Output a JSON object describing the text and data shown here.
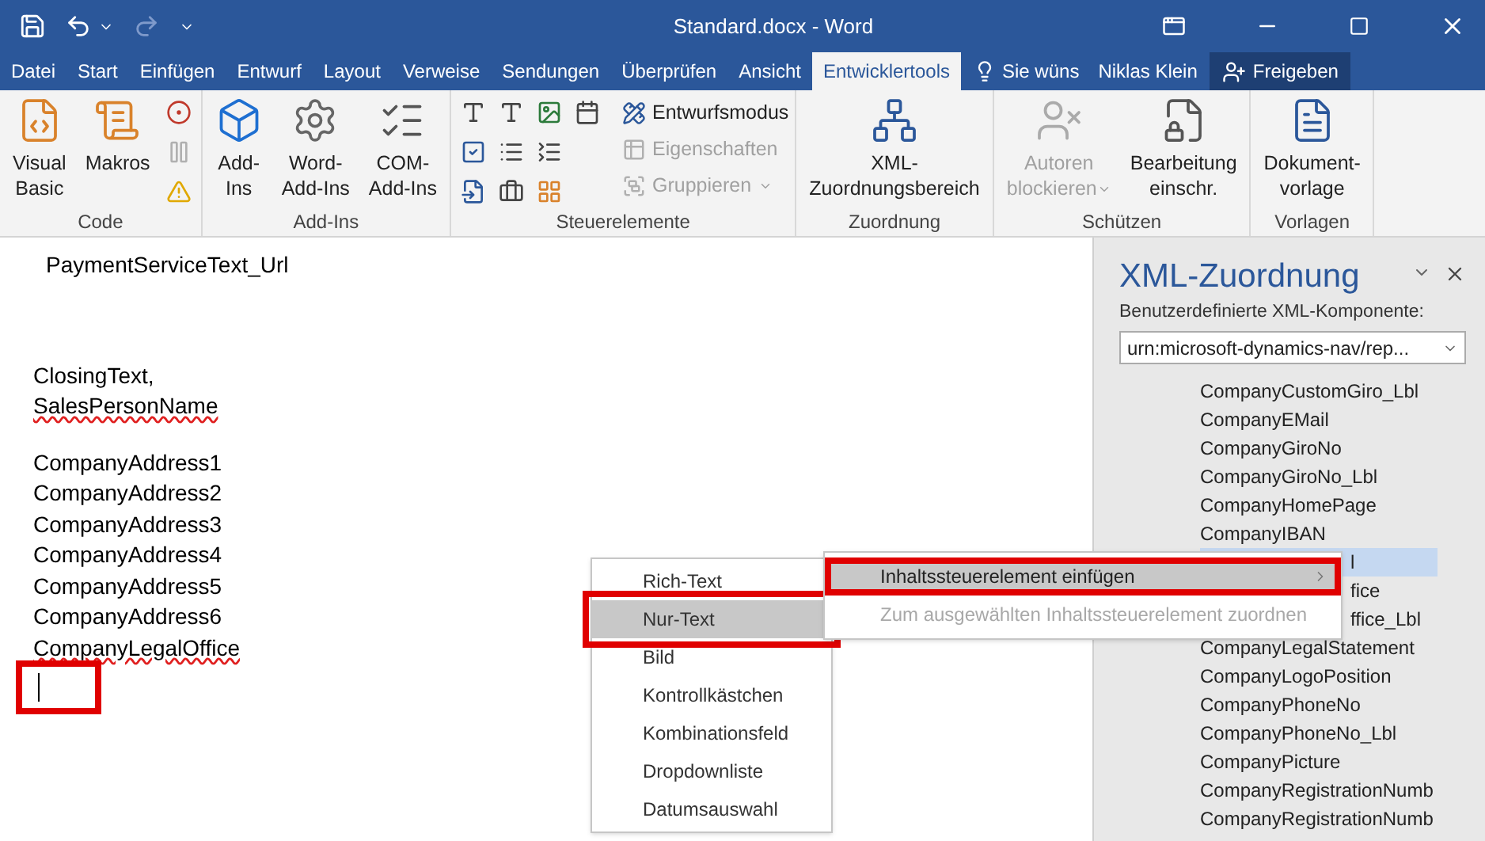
{
  "window": {
    "title": "Standard.docx - Word",
    "redo_disabled": true
  },
  "tabs": [
    {
      "label": "Datei",
      "selected": false
    },
    {
      "label": "Start",
      "selected": false
    },
    {
      "label": "Einfügen",
      "selected": false
    },
    {
      "label": "Entwurf",
      "selected": false
    },
    {
      "label": "Layout",
      "selected": false
    },
    {
      "label": "Verweise",
      "selected": false
    },
    {
      "label": "Sendungen",
      "selected": false
    },
    {
      "label": "Überprüfen",
      "selected": false
    },
    {
      "label": "Ansicht",
      "selected": false
    },
    {
      "label": "Entwicklertools",
      "selected": true
    }
  ],
  "tell_me": "Sie wüns",
  "user": "Niklas Klein",
  "share_button": "Freigeben",
  "ribbon_groups": [
    {
      "label": "Code",
      "items": [
        {
          "kind": "large",
          "lines": [
            "Visual",
            "Basic"
          ],
          "disabled": false
        },
        {
          "kind": "large",
          "lines": [
            "Makros"
          ],
          "disabled": false
        },
        {
          "kind": "icon",
          "disabled": false
        },
        {
          "kind": "icon",
          "disabled": true
        },
        {
          "kind": "icon",
          "disabled": false
        }
      ]
    },
    {
      "label": "Add-Ins",
      "items": [
        {
          "kind": "large",
          "lines": [
            "Add-",
            "Ins"
          ],
          "disabled": false
        },
        {
          "kind": "large",
          "lines": [
            "Word-",
            "Add-Ins"
          ],
          "disabled": false
        },
        {
          "kind": "large",
          "lines": [
            "COM-",
            "Add-Ins"
          ],
          "disabled": false
        }
      ]
    },
    {
      "label": "Steuerelemente",
      "items": [
        {
          "kind": "icon",
          "disabled": false
        },
        {
          "kind": "icon",
          "disabled": false
        },
        {
          "kind": "icon",
          "disabled": false
        },
        {
          "kind": "icon",
          "disabled": false
        },
        {
          "kind": "icon",
          "disabled": false
        },
        {
          "kind": "icon",
          "disabled": false
        },
        {
          "kind": "icon",
          "disabled": false
        },
        {
          "kind": "icon",
          "disabled": false
        },
        {
          "kind": "icon",
          "disabled": false
        },
        {
          "kind": "icon",
          "disabled": false
        },
        {
          "kind": "small",
          "label": "Entwurfsmodus",
          "disabled": false,
          "has_menu": false
        },
        {
          "kind": "small",
          "label": "Eigenschaften",
          "disabled": true,
          "has_menu": false
        },
        {
          "kind": "small",
          "label": "Gruppieren",
          "disabled": true,
          "has_menu": true
        }
      ]
    },
    {
      "label": "Zuordnung",
      "items": [
        {
          "kind": "large",
          "lines": [
            "XML-",
            "Zuordnungsbereich"
          ],
          "disabled": false
        }
      ]
    },
    {
      "label": "Schützen",
      "items": [
        {
          "kind": "large",
          "lines": [
            "Autoren",
            "blockieren"
          ],
          "disabled": true,
          "has_menu": true
        },
        {
          "kind": "large",
          "lines": [
            "Bearbeitung",
            "einschr."
          ],
          "disabled": false
        }
      ]
    },
    {
      "label": "Vorlagen",
      "items": [
        {
          "kind": "large",
          "lines": [
            "Dokument-",
            "vorlage"
          ],
          "disabled": false
        }
      ]
    }
  ],
  "document": {
    "blocks": [
      [
        {
          "text": "PaymentServiceText_Url",
          "spelling_error": false
        }
      ],
      [
        {
          "text": "ClosingText,",
          "spelling_error": false
        },
        {
          "text": "SalesPersonName",
          "spelling_error": true
        }
      ],
      [
        {
          "text": "CompanyAddress1",
          "spelling_error": false
        },
        {
          "text": "CompanyAddress2",
          "spelling_error": false
        },
        {
          "text": "CompanyAddress3",
          "spelling_error": false
        },
        {
          "text": "CompanyAddress4",
          "spelling_error": false
        },
        {
          "text": "CompanyAddress5",
          "spelling_error": false
        },
        {
          "text": "CompanyAddress6",
          "spelling_error": false
        },
        {
          "text": "CompanyLegalOffice",
          "spelling_error": true
        }
      ]
    ],
    "cursor_annotated": true
  },
  "xml_pane": {
    "title": "XML-Zuordnung",
    "label": "Benutzerdefinierte XML-Komponente:",
    "dropdown_value": "urn:microsoft-dynamics-nav/rep...",
    "items": [
      {
        "text": "CompanyCustomGiro_Lbl",
        "selected": false,
        "partial": false
      },
      {
        "text": "CompanyEMail",
        "selected": false,
        "partial": false
      },
      {
        "text": "CompanyGiroNo",
        "selected": false,
        "partial": false
      },
      {
        "text": "CompanyGiroNo_Lbl",
        "selected": false,
        "partial": false
      },
      {
        "text": "CompanyHomePage",
        "selected": false,
        "partial": false
      },
      {
        "text": "CompanyIBAN",
        "selected": false,
        "partial": false
      },
      {
        "text": "l",
        "selected": true,
        "partial": true
      },
      {
        "text": "fice",
        "selected": false,
        "partial": true
      },
      {
        "text": "ffice_Lbl",
        "selected": false,
        "partial": true
      },
      {
        "text": "CompanyLegalStatement",
        "selected": false,
        "partial": false
      },
      {
        "text": "CompanyLogoPosition",
        "selected": false,
        "partial": false
      },
      {
        "text": "CompanyPhoneNo",
        "selected": false,
        "partial": false
      },
      {
        "text": "CompanyPhoneNo_Lbl",
        "selected": false,
        "partial": false
      },
      {
        "text": "CompanyPicture",
        "selected": false,
        "partial": false
      },
      {
        "text": "CompanyRegistrationNumb",
        "selected": false,
        "partial": false
      },
      {
        "text": "CompanyRegistrationNumb",
        "selected": false,
        "partial": false
      }
    ]
  },
  "context_menu": [
    {
      "label": "Inhaltssteuerelement einfügen",
      "hovered": true,
      "disabled": false,
      "has_submenu": true,
      "annotated": true
    },
    {
      "label": "Zum ausgewählten Inhaltssteuerelement zuordnen",
      "hovered": false,
      "disabled": true,
      "has_submenu": false,
      "annotated": false
    }
  ],
  "submenu": [
    {
      "label": "Rich-Text",
      "hovered": false,
      "annotated": false
    },
    {
      "label": "Nur-Text",
      "hovered": true,
      "annotated": true
    },
    {
      "label": "Bild",
      "hovered": false,
      "annotated": false
    },
    {
      "label": "Kontrollkästchen",
      "hovered": false,
      "annotated": false
    },
    {
      "label": "Kombinationsfeld",
      "hovered": false,
      "annotated": false
    },
    {
      "label": "Dropdownliste",
      "hovered": false,
      "annotated": false
    },
    {
      "label": "Datumsauswahl",
      "hovered": false,
      "annotated": false
    }
  ]
}
